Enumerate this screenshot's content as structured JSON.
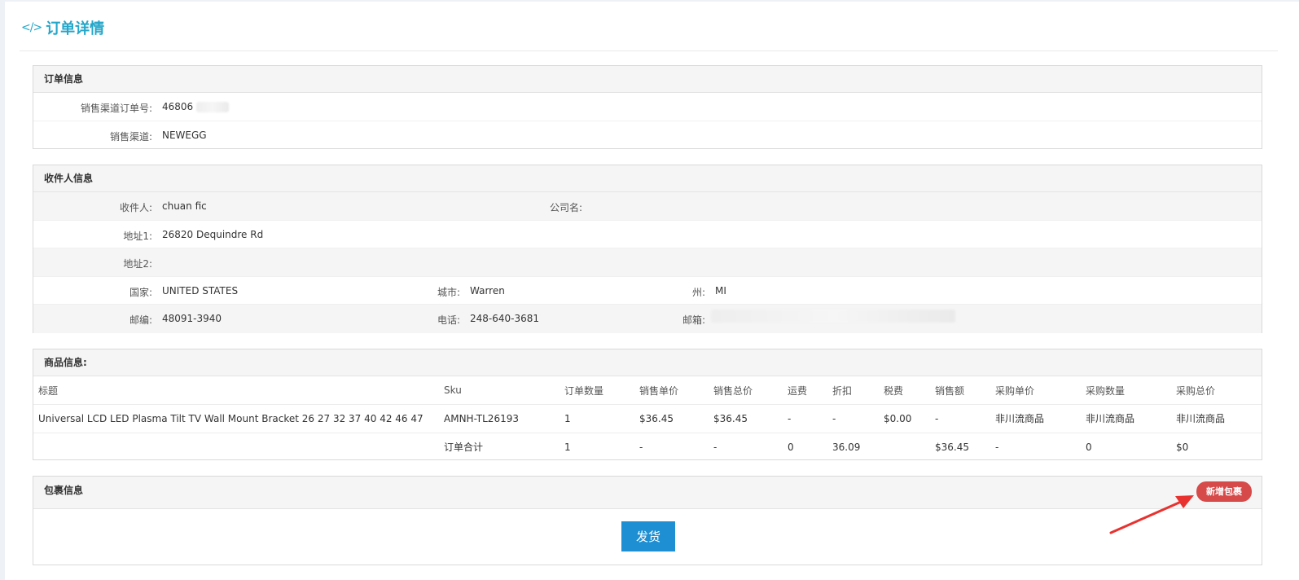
{
  "page": {
    "title": "订单详情"
  },
  "order_info": {
    "heading": "订单信息",
    "channel_order_no_label": "销售渠道订单号:",
    "channel_order_no": "46806",
    "channel_label": "销售渠道:",
    "channel": "NEWEGG"
  },
  "recipient": {
    "heading": "收件人信息",
    "name_label": "收件人:",
    "name": "chuan fic",
    "company_label": "公司名:",
    "company": "",
    "addr1_label": "地址1:",
    "addr1": "26820 Dequindre Rd",
    "addr2_label": "地址2:",
    "addr2": "",
    "country_label": "国家:",
    "country": "UNITED STATES",
    "city_label": "城市:",
    "city": "Warren",
    "state_label": "州:",
    "state": "MI",
    "zip_label": "邮编:",
    "zip": "48091-3940",
    "phone_label": "电话:",
    "phone": "248-640-3681",
    "email_label": "邮箱:",
    "email": ""
  },
  "goods": {
    "heading": "商品信息:",
    "columns": [
      "标题",
      "Sku",
      "订单数量",
      "销售单价",
      "销售总价",
      "运费",
      "折扣",
      "税费",
      "销售额",
      "采购单价",
      "采购数量",
      "采购总价"
    ],
    "rows": [
      [
        "Universal LCD LED Plasma Tilt TV Wall Mount Bracket 26 27 32 37 40 42 46 47",
        "AMNH-TL26193",
        "1",
        "$36.45",
        "$36.45",
        "-",
        "-",
        "$0.00",
        "-",
        "非川流商品",
        "非川流商品",
        "非川流商品"
      ]
    ],
    "total_row": [
      "",
      "订单合计",
      "1",
      "-",
      "-",
      "0",
      "36.09",
      "",
      "$36.45",
      "-",
      "0",
      "$0"
    ]
  },
  "package": {
    "heading": "包裹信息",
    "add_button": "新增包裹",
    "ship_button": "发货"
  },
  "colors": {
    "accent": "#25a6c9",
    "danger": "#d64a4a",
    "primary": "#1e8fd2",
    "annotation_arrow": "#e8322f"
  },
  "icons": {
    "title_icon": "code-icon"
  }
}
